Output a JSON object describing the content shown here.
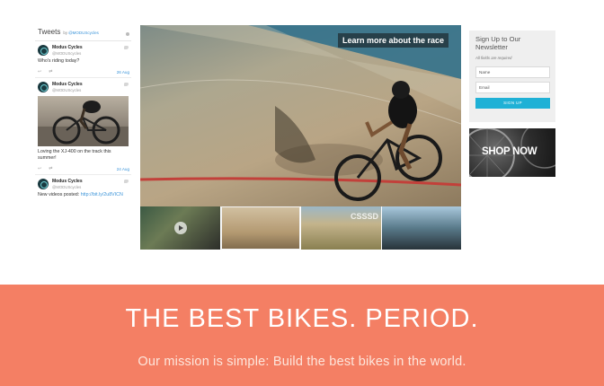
{
  "twitter": {
    "title": "Tweets",
    "by": "by",
    "handle": "@MODUScycles",
    "tweets": [
      {
        "name": "Modus Cycles",
        "handle": "@MODUScycles",
        "text": "Who's riding today?",
        "date": "26 Aug"
      },
      {
        "name": "Modus Cycles",
        "handle": "@MODUScycles",
        "text": "Loving the XJ-400 on the track this summer!",
        "date": "24 Aug"
      },
      {
        "name": "Modus Cycles",
        "handle": "@MODUScycles",
        "text": "New videos posted: ",
        "link": "http://bit.ly/2u8VICN",
        "date": "24 Aug"
      }
    ]
  },
  "hero": {
    "caption": "Learn more about the race",
    "thumb_text": "CSSSD"
  },
  "newsletter": {
    "title": "Sign Up to Our Newsletter",
    "note": "All fields are required",
    "name_placeholder": "Name",
    "email_placeholder": "Email",
    "button_label": "SIGN UP"
  },
  "shop": {
    "label": "SHOP NOW"
  },
  "banner": {
    "title": "THE BEST BIKES. PERIOD.",
    "subtitle": "Our mission is simple: Build the best bikes in the world."
  },
  "icons": {
    "tweet_avatar": "modus-logo-icon",
    "reply": "reply-icon",
    "retweet": "retweet-icon",
    "twitter_bird": "twitter-bird-icon",
    "play": "play-icon"
  },
  "colors": {
    "banner": "#f47f64",
    "signup_button": "#1fb1d6",
    "link": "#3b94d9"
  }
}
